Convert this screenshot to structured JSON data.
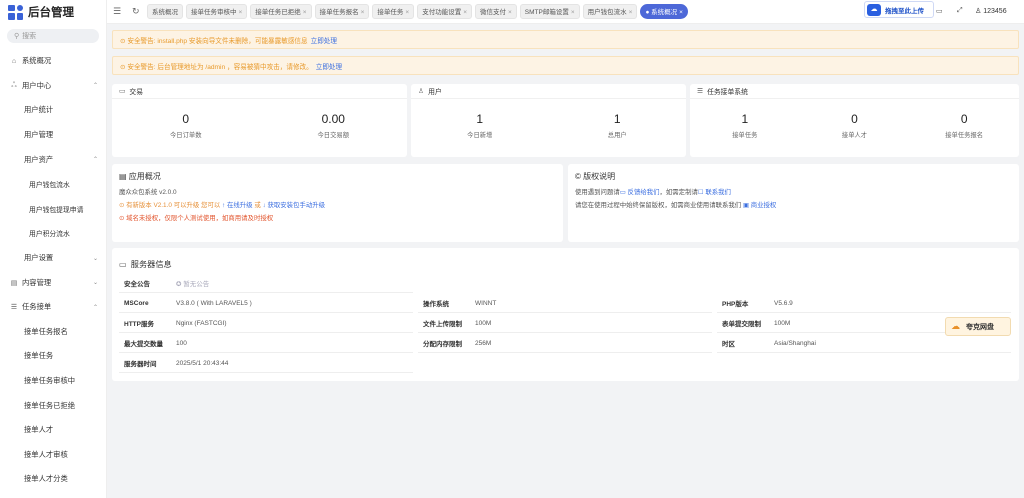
{
  "app": {
    "title": "后台管理"
  },
  "search": {
    "placeholder": "搜索"
  },
  "sidebar": {
    "items": [
      {
        "label": "系统概况",
        "icon": "home-icon",
        "level": 1
      },
      {
        "label": "用户中心",
        "icon": "users-icon",
        "level": 1,
        "expanded": true
      },
      {
        "label": "用户统计",
        "level": 2
      },
      {
        "label": "用户管理",
        "level": 2
      },
      {
        "label": "用户资产",
        "level": 2,
        "expanded": true
      },
      {
        "label": "用户钱包流水",
        "level": 3
      },
      {
        "label": "用户钱包提现申请",
        "level": 3
      },
      {
        "label": "用户积分流水",
        "level": 3
      },
      {
        "label": "用户设置",
        "level": 2,
        "collapsed": true
      },
      {
        "label": "内容管理",
        "icon": "document-icon",
        "level": 1,
        "collapsed": true
      },
      {
        "label": "任务接单",
        "icon": "list-icon",
        "level": 1,
        "expanded": true
      },
      {
        "label": "接单任务报名",
        "level": 2
      },
      {
        "label": "接单任务",
        "level": 2
      },
      {
        "label": "接单任务审核中",
        "level": 2
      },
      {
        "label": "接单任务已拒绝",
        "level": 2
      },
      {
        "label": "接单人才",
        "level": 2
      },
      {
        "label": "接单人才审核",
        "level": 2
      },
      {
        "label": "接单人才分类",
        "level": 2
      }
    ]
  },
  "tabs": [
    "系统概况",
    "接单任务审核中",
    "接单任务已拒绝",
    "接单任务报名",
    "接单任务",
    "支付功能设置",
    "微信支付",
    "SMTP邮箱设置",
    "用户钱包流水",
    "● 系统概况"
  ],
  "upload": {
    "label": "拖拽至此上传"
  },
  "user": {
    "name": "123456"
  },
  "alerts": [
    {
      "text": "⊙ 安全警告: install.php 安装向导文件未删除，可能暴露敏感信息",
      "link": "立即处理"
    },
    {
      "text": "⊙ 安全警告: 后台管理地址为 /admin ，容易被猜中攻击，请修改。",
      "link": "立即处理"
    }
  ],
  "cards": {
    "trade": {
      "title": "交易",
      "stats": [
        {
          "value": "0",
          "label": "今日订单数"
        },
        {
          "value": "0.00",
          "label": "今日交易额"
        }
      ]
    },
    "users": {
      "title": "用户",
      "stats": [
        {
          "value": "1",
          "label": "今日新增"
        },
        {
          "value": "1",
          "label": "总用户"
        }
      ]
    },
    "task": {
      "title": "任务接单系统",
      "stats": [
        {
          "value": "1",
          "label": "接单任务"
        },
        {
          "value": "0",
          "label": "接单人才"
        },
        {
          "value": "0",
          "label": "接单任务报名"
        }
      ]
    }
  },
  "app_overview": {
    "title": "应用概况",
    "system": "魔众众包系统 v2.0.0",
    "upgrade_text": "⊙ 有新版本 V2.1.0 可以升级 您可以",
    "upgrade_online": "↑ 在线升级",
    "or": "或",
    "upgrade_package": "↓ 获取安装包手动升级",
    "license_text": "⊙ 域名未授权，仅限个人测试使用，如商用请及时授权"
  },
  "copyright": {
    "title": "版权说明",
    "line1_text": "使用遇到问题请",
    "line1_link1": "▭ 反馈给我们",
    "line1_mid": "，如需定制请",
    "line1_link2": "☐ 联系我们",
    "line2_text": "请您在使用过程中始终保留版权，如需商业使用请联系我们",
    "line2_link": "▣ 商业授权"
  },
  "server": {
    "title": "服务器信息",
    "announce_label": "安全公告",
    "announce_value": "✪ 暂无公告",
    "rows": [
      [
        {
          "k": "MSCore",
          "v": "V3.8.0 ( With LARAVEL5 )"
        },
        {
          "k": "操作系统",
          "v": "WINNT"
        },
        {
          "k": "PHP版本",
          "v": "V5.6.9"
        }
      ],
      [
        {
          "k": "HTTP服务",
          "v": "Nginx (FASTCGI)"
        },
        {
          "k": "文件上传限制",
          "v": "100M"
        },
        {
          "k": "表单提交限制",
          "v": "100M"
        }
      ],
      [
        {
          "k": "最大提交数量",
          "v": "100"
        },
        {
          "k": "分配内存限制",
          "v": "256M"
        },
        {
          "k": "时区",
          "v": "Asia/Shanghai"
        }
      ],
      [
        {
          "k": "服务器时间",
          "v": "2025/5/1 20:43:44"
        }
      ]
    ]
  },
  "float_disk": {
    "label": "夸克网盘"
  }
}
